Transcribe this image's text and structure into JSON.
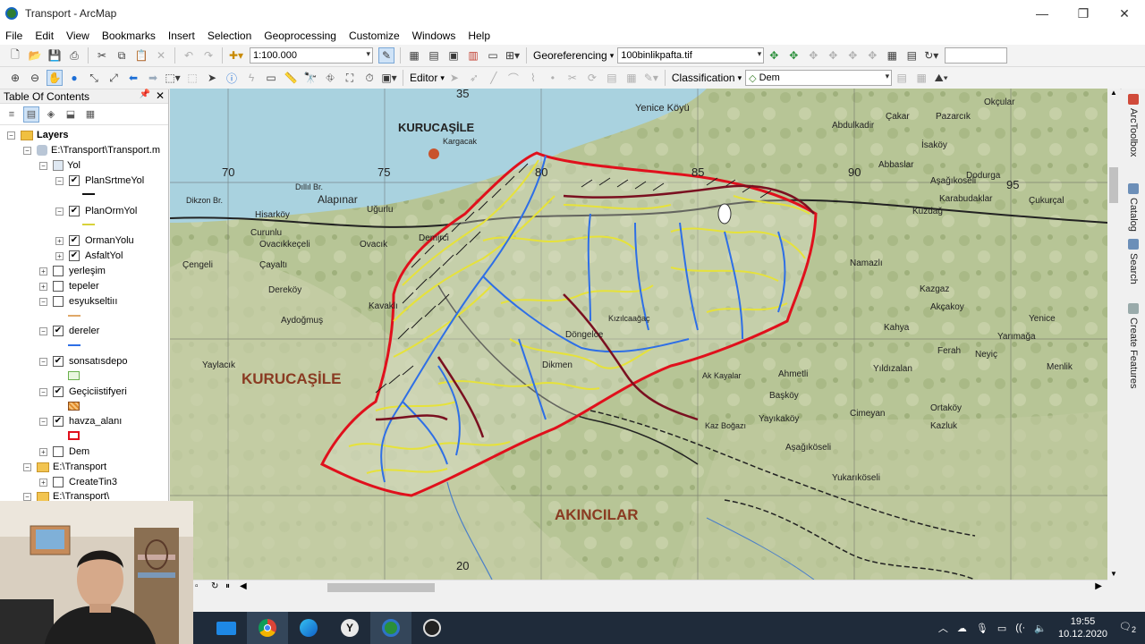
{
  "window": {
    "title": "Transport - ArcMap",
    "minimize": "—",
    "maximize": "❐",
    "close": "✕"
  },
  "menu": [
    "File",
    "Edit",
    "View",
    "Bookmarks",
    "Insert",
    "Selection",
    "Geoprocessing",
    "Customize",
    "Windows",
    "Help"
  ],
  "toolbar": {
    "scale_value": "1:100.000",
    "georeferencing_label": "Georeferencing",
    "georef_layer": "100binlikpafta.tif",
    "editor_label": "Editor",
    "classification_label": "Classification",
    "classification_layer": "Dem"
  },
  "toc": {
    "title": "Table Of Contents",
    "layers_root": "Layers",
    "mxd_path": "E:\\Transport\\Transport.m",
    "group_yol": "Yol",
    "items": [
      {
        "label": "PlanSrtmeYol",
        "checked": true
      },
      {
        "label": "PlanOrmYol",
        "checked": true
      },
      {
        "label": "OrmanYolu",
        "checked": true
      },
      {
        "label": "AsfaltYol",
        "checked": true
      },
      {
        "label": "yerleşim",
        "checked": false
      },
      {
        "label": "tepeler",
        "checked": false
      },
      {
        "label": "esyukseltiıı",
        "checked": false
      },
      {
        "label": "dereler",
        "checked": true
      },
      {
        "label": "sonsatısdepo",
        "checked": true
      },
      {
        "label": "Geçiciistifyeri",
        "checked": true
      },
      {
        "label": "havza_alanı",
        "checked": true
      },
      {
        "label": "Dem",
        "checked": false
      }
    ],
    "folder1": "E:\\Transport",
    "folder1_child": "CreateTin3",
    "folder2": "E:\\Transport\\"
  },
  "map": {
    "village_labels": [
      "KURUCAŞİLE",
      "Kargacak",
      "Yenice Köyü",
      "Okçular",
      "Alapınar",
      "Hisarköy",
      "Uğurlu",
      "Demirci",
      "Dikzon Br.",
      "Dıllıl Br.",
      "Curunlu",
      "Ovacıkkeçeli",
      "Ovacık",
      "Çengeli",
      "Çayaltı",
      "Dereköy",
      "Aydoğmuş",
      "Kavaklı",
      "Yaylacık",
      "Kazgaz",
      "Akçakoy",
      "Kahya",
      "Yıldızalan",
      "Ferah",
      "Neyiç",
      "Menlik",
      "Başköy",
      "Yayıkaköy",
      "Cimeyan",
      "Kazluk",
      "Yukarıköseli",
      "Aşağıköseli",
      "Abdulkadir",
      "Çakar",
      "Pazarcık",
      "Aşağıkoseli",
      "İsaköy",
      "Abbaslar",
      "Karabudaklar",
      "Çukurçal",
      "Namazlı",
      "Yenice",
      "Ak Kayalar",
      "Kaz Boğazı",
      "Döngelce",
      "Dikmen",
      "Kuzdağ",
      "Kızılcaağaç",
      "Ahmetli",
      "Dodurga",
      "Yarımağa",
      "Ortaköy"
    ],
    "region_labels": [
      "KURUCAŞİLE",
      "AKINCILAR"
    ],
    "grid_labels": [
      "70",
      "75",
      "80",
      "85",
      "90",
      "95",
      "35",
      "20"
    ]
  },
  "taskbar": {
    "time": "19:55",
    "date": "10.12.2020",
    "notifications": "2"
  },
  "colors": {
    "watershed_boundary": "#e0101c",
    "streams": "#2e6fe6",
    "forest_roads": "#e6e23a",
    "asphalt_roads": "#1a1a1a",
    "planned_roads": "#7a1020",
    "map_base": "#b9c79a"
  }
}
